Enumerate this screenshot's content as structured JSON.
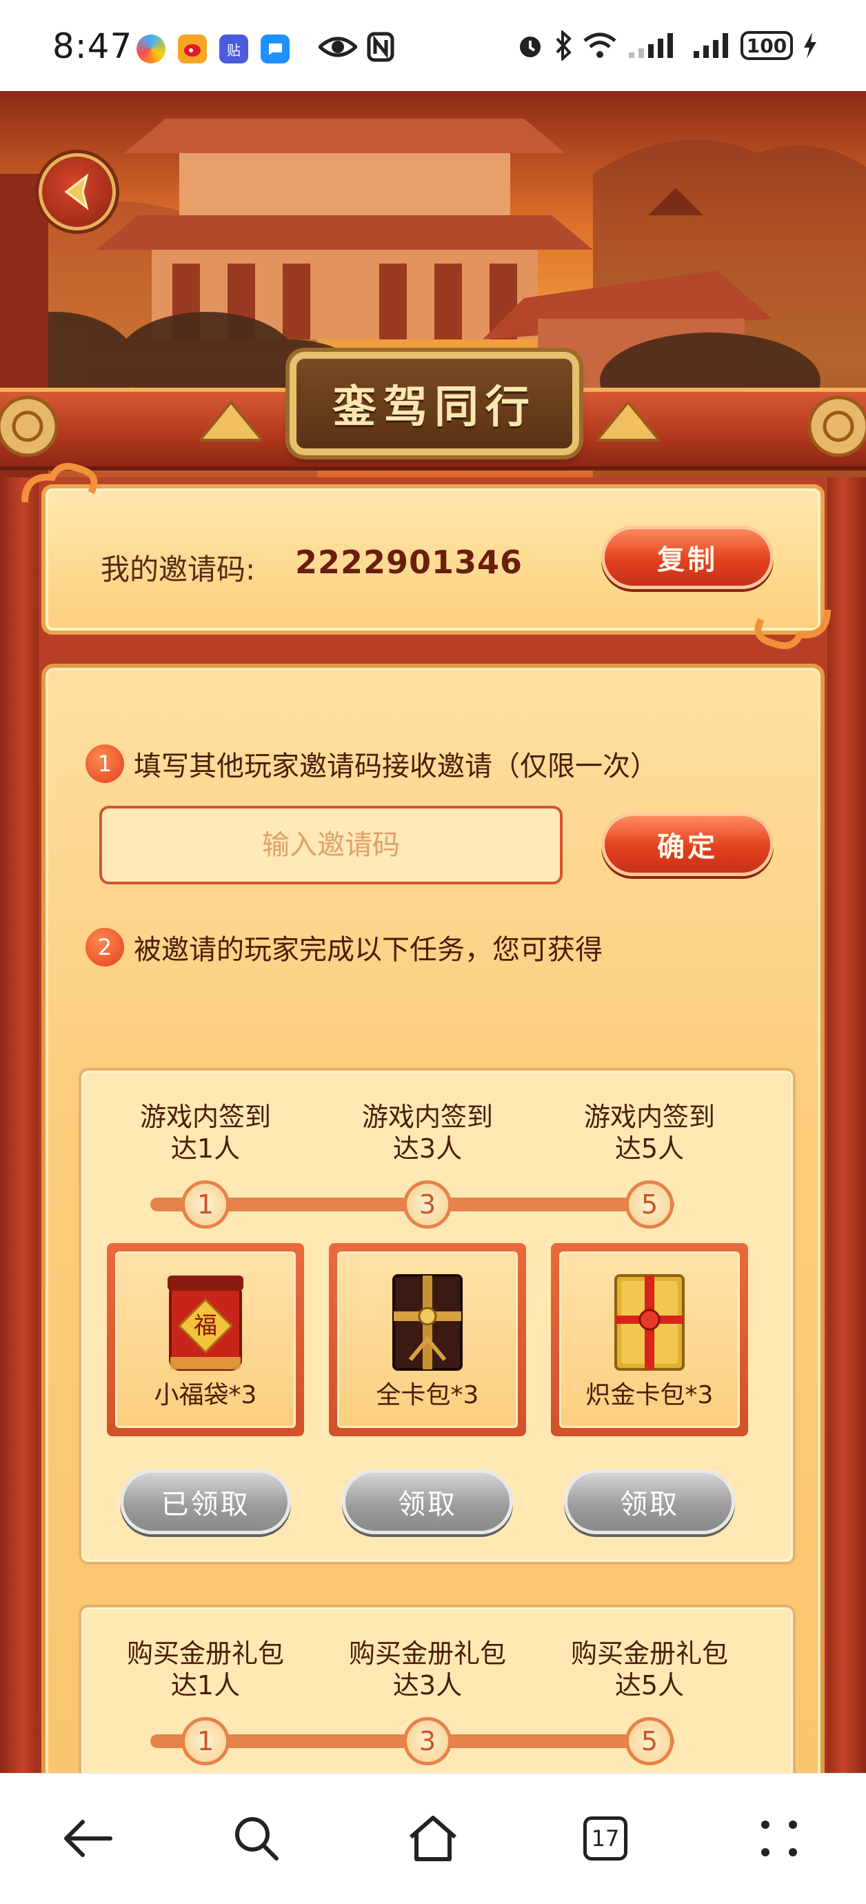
{
  "status_bar": {
    "time": "8:47",
    "battery": "100",
    "icons": [
      "app-icon-1",
      "weibo-icon",
      "tieba-icon",
      "message-icon",
      "eye-icon",
      "nfc-icon",
      "alarm-icon",
      "bluetooth-icon",
      "wifi-icon",
      "signal-icon",
      "signal-icon",
      "charging-icon"
    ]
  },
  "header": {
    "title": "銮驾同行"
  },
  "invite_code": {
    "label": "我的邀请码:",
    "value": "2222901346",
    "copy_label": "复制"
  },
  "step1": {
    "number": "1",
    "text": "填写其他玩家邀请码接收邀请（仅限一次）",
    "input_placeholder": "输入邀请码",
    "confirm_label": "确定"
  },
  "step2": {
    "number": "2",
    "text": "被邀请的玩家完成以下任务，您可获得"
  },
  "task_groups": [
    {
      "tiers": [
        {
          "label_line1": "游戏内签到",
          "label_line2": "达1人",
          "milestone": "1",
          "reward": "小福袋*3",
          "button": "已领取"
        },
        {
          "label_line1": "游戏内签到",
          "label_line2": "达3人",
          "milestone": "3",
          "reward": "全卡包*3",
          "button": "领取"
        },
        {
          "label_line1": "游戏内签到",
          "label_line2": "达5人",
          "milestone": "5",
          "reward": "炽金卡包*3",
          "button": "领取"
        }
      ]
    },
    {
      "tiers": [
        {
          "label_line1": "购买金册礼包",
          "label_line2": "达1人",
          "milestone": "1"
        },
        {
          "label_line1": "购买金册礼包",
          "label_line2": "达3人",
          "milestone": "3"
        },
        {
          "label_line1": "购买金册礼包",
          "label_line2": "达5人",
          "milestone": "5"
        }
      ]
    }
  ],
  "nav": {
    "tab_count": "17",
    "items": [
      "back-icon",
      "search-icon",
      "home-icon",
      "tabs-icon",
      "more-icon"
    ]
  },
  "colors": {
    "frame_red": "#c0442a",
    "panel_gold": "#fbcc7a",
    "button_red": "#e2401f",
    "button_grey": "#9a9a9a",
    "title_plaque": "#5a3214"
  }
}
